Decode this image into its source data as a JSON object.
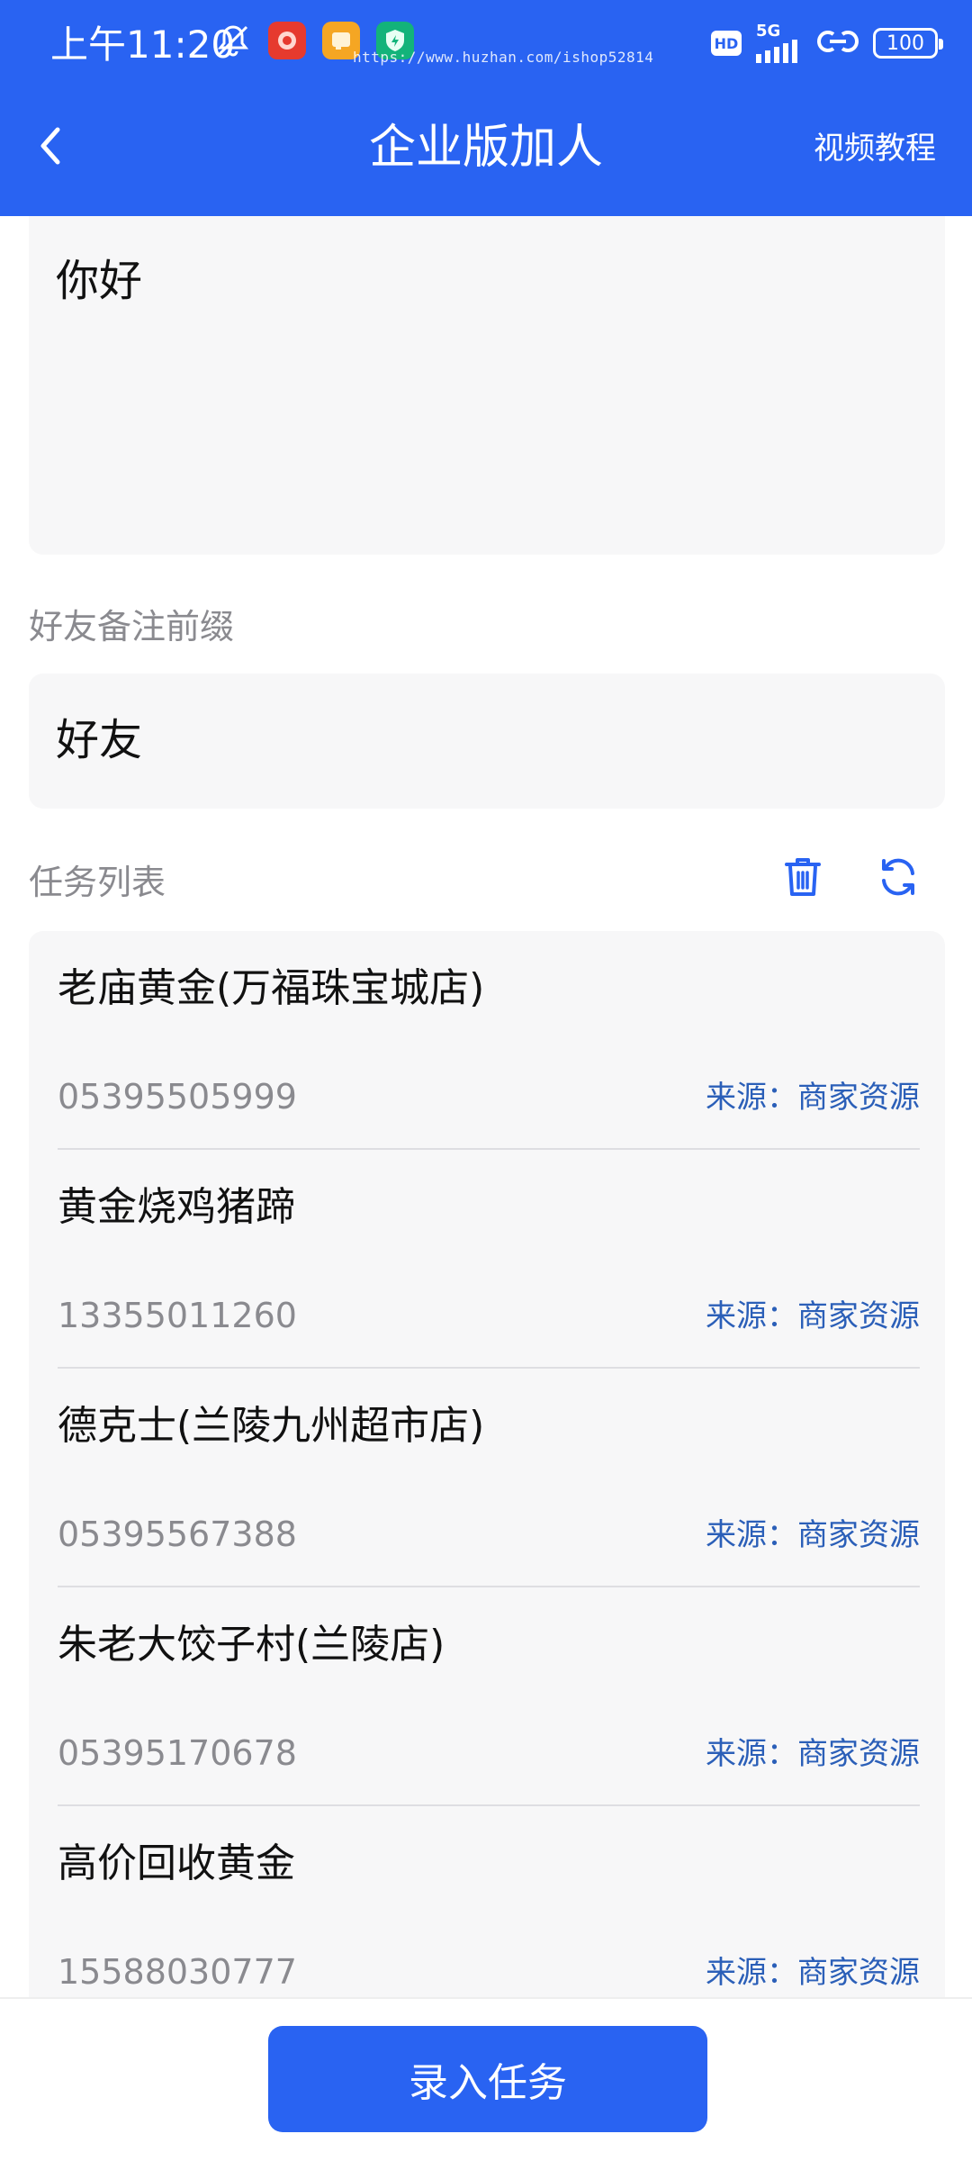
{
  "status_bar": {
    "time": "上午11:20",
    "url_watermark": "https://www.huzhan.com/ishop52814",
    "network": "5G",
    "hd": "HD",
    "battery": "100",
    "left_icons": [
      "bell-off-icon",
      "app-icon-red",
      "app-icon-orange",
      "app-icon-green-shield"
    ],
    "colors": {
      "background": "#2963f2"
    }
  },
  "header": {
    "back_icon": "chevron-left-icon",
    "title": "企业版加人",
    "right_action": "视频教程"
  },
  "greeting": {
    "value": "你好"
  },
  "friend_prefix": {
    "label": "好友备注前缀",
    "value": "好友"
  },
  "task_list": {
    "label": "任务列表",
    "delete_icon": "trash-icon",
    "refresh_icon": "refresh-icon",
    "items": [
      {
        "name": "老庙黄金(万福珠宝城店)",
        "phone": "05395505999",
        "source": "来源：商家资源"
      },
      {
        "name": "黄金烧鸡猪蹄",
        "phone": "13355011260",
        "source": "来源：商家资源"
      },
      {
        "name": "德克士(兰陵九州超市店)",
        "phone": "05395567388",
        "source": "来源：商家资源"
      },
      {
        "name": "朱老大饺子村(兰陵店)",
        "phone": "05395170678",
        "source": "来源：商家资源"
      },
      {
        "name": "高价回收黄金",
        "phone": "15588030777",
        "source": "来源：商家资源"
      }
    ]
  },
  "footer": {
    "submit_label": "录入任务"
  },
  "colors": {
    "accent": "#2963f2",
    "source_text": "#2b5fb8",
    "muted_text": "#8a8a8f",
    "field_bg": "#f7f7f8"
  }
}
